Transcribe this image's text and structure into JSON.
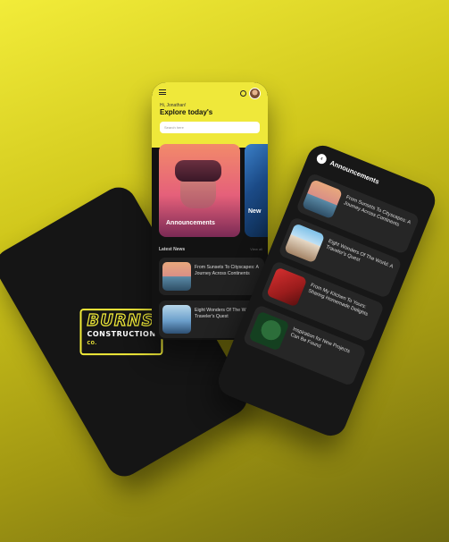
{
  "brand": {
    "name_top": "BURNS",
    "name_bottom": "CONSTRUCTION",
    "suffix": "CO."
  },
  "home": {
    "greeting": "Hi, Jonathan!",
    "title": "Explore today's",
    "search_placeholder": "Search here",
    "featured": [
      {
        "label": "Announcements"
      },
      {
        "label": "New"
      }
    ],
    "latest_title": "Latest News",
    "view_all": "View all",
    "news": [
      {
        "title": "From Sunsets To Cityscapes: A Journey Across Continents"
      },
      {
        "title": "Eight Wonders Of The World: A Traveler's Quest"
      }
    ]
  },
  "announcements": {
    "title": "Announcements",
    "items": [
      {
        "title": "From Sunsets To Cityscapes: A Journey Across Continents"
      },
      {
        "title": "Eight Wonders Of The World: A Traveler's Quest"
      },
      {
        "title": "From My Kitchen To Yours: Sharing Homemade Delights"
      },
      {
        "title": "Inspiration for New Projects Can Be Found"
      }
    ]
  },
  "colors": {
    "accent": "#efe83a",
    "dark": "#161616",
    "card": "#262626"
  }
}
